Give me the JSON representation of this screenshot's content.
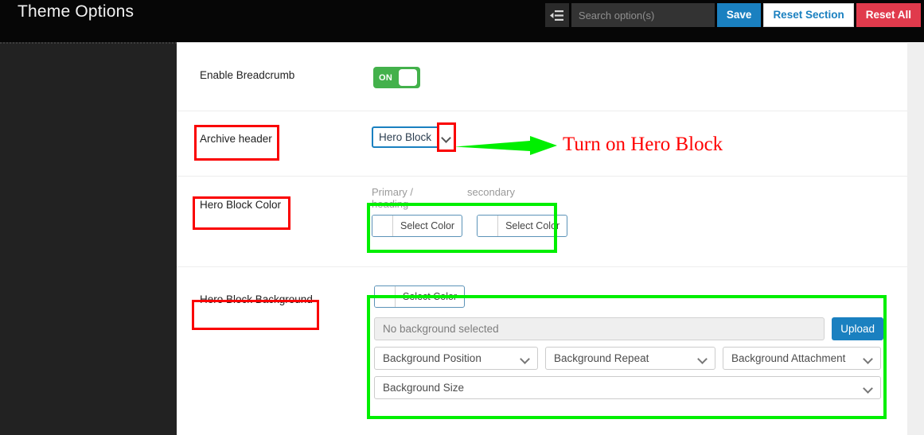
{
  "header": {
    "title": "Theme Options",
    "panel_toggle_icon": "list-indent-icon",
    "search": {
      "placeholder": "Search option(s)",
      "value": ""
    },
    "save_label": "Save",
    "reset_section_label": "Reset Section",
    "reset_all_label": "Reset All",
    "accent_blue": "#1a80c0",
    "danger_red": "#e03a4c",
    "bar_background": "#060606"
  },
  "sidebar": {
    "background": "#222222"
  },
  "rows": {
    "breadcrumb": {
      "label": "Enable Breadcrumb",
      "toggle_state": "ON",
      "toggle_color": "#43b14b"
    },
    "archive_header": {
      "label": "Archive header",
      "select_value": "Hero Block",
      "select_border": "#1a80c0",
      "chevron_icon": "chevron-down-icon"
    },
    "hero_block_color": {
      "label": "Hero Block Color",
      "fields": [
        {
          "caption": "Primary / heading",
          "button_label": "Select Color",
          "swatch": "#ffffff"
        },
        {
          "caption": "secondary",
          "button_label": "Select Color",
          "swatch": "#ffffff"
        }
      ]
    },
    "hero_block_background": {
      "label": "Hero Block Background",
      "color_button_label": "Select Color",
      "color_swatch": "#ffffff",
      "file_field_text": "No background selected",
      "upload_label": "Upload",
      "selects": [
        "Background Position",
        "Background Repeat",
        "Background Attachment",
        "Background Size"
      ]
    }
  },
  "annotations": {
    "arrow_color": "#00ef00",
    "box_red": "#fa0000",
    "box_green": "#00ef00",
    "callout_text": "Turn on Hero Block",
    "callout_color": "#ff0000"
  }
}
